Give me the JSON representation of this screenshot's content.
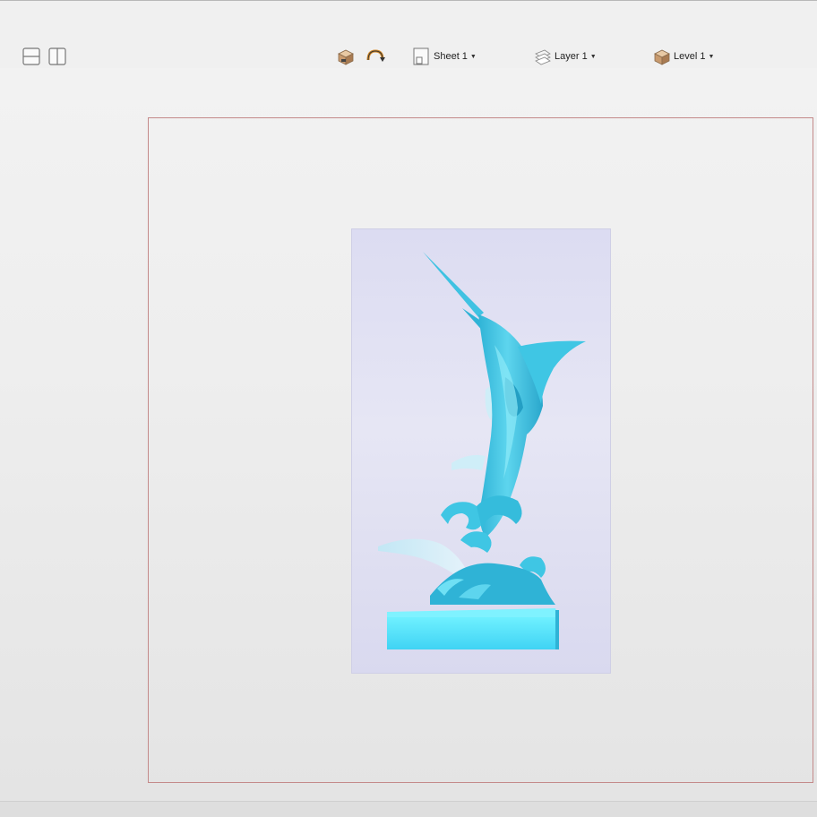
{
  "toolbar": {
    "view_toggles": [
      {
        "icon": "split-horizontal-icon"
      },
      {
        "icon": "split-vertical-icon"
      }
    ],
    "tools": [
      {
        "icon": "relief-box-icon"
      },
      {
        "icon": "rotate-arc-icon"
      }
    ],
    "sheet_selector": {
      "icon": "sheet-icon",
      "label": "Sheet 1"
    },
    "layer_selector": {
      "icon": "layer-icon",
      "label": "Layer 1"
    },
    "level_selector": {
      "icon": "level-icon",
      "label": "Level 1"
    }
  },
  "colors": {
    "relief_cyan": "#3fc6e4",
    "relief_highlight": "#7fe6f5",
    "relief_base": "#55e6fb",
    "model_block": "#dedef2",
    "sheet_border": "#c48a8a"
  },
  "viewport": {
    "model_name": "marlin-relief-model"
  }
}
